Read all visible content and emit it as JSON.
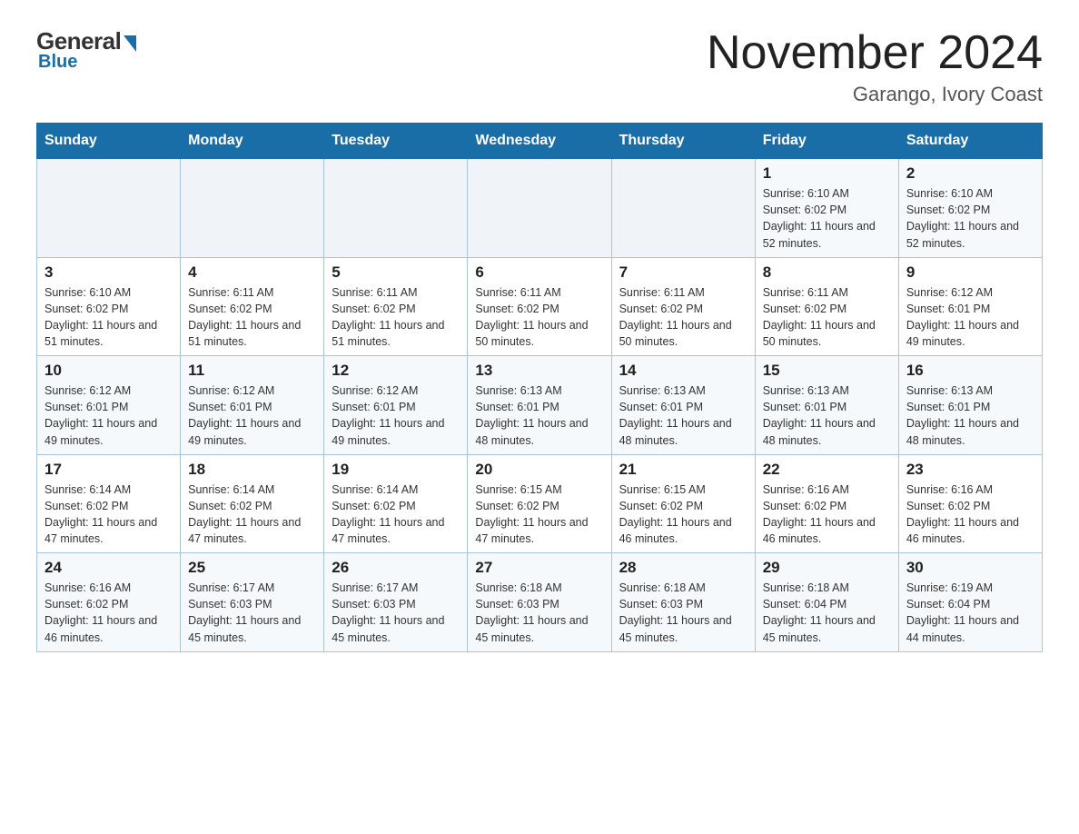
{
  "logo": {
    "general": "General",
    "blue": "Blue"
  },
  "header": {
    "month_year": "November 2024",
    "location": "Garango, Ivory Coast"
  },
  "days_of_week": [
    "Sunday",
    "Monday",
    "Tuesday",
    "Wednesday",
    "Thursday",
    "Friday",
    "Saturday"
  ],
  "weeks": [
    [
      {
        "day": "",
        "info": ""
      },
      {
        "day": "",
        "info": ""
      },
      {
        "day": "",
        "info": ""
      },
      {
        "day": "",
        "info": ""
      },
      {
        "day": "",
        "info": ""
      },
      {
        "day": "1",
        "info": "Sunrise: 6:10 AM\nSunset: 6:02 PM\nDaylight: 11 hours and 52 minutes."
      },
      {
        "day": "2",
        "info": "Sunrise: 6:10 AM\nSunset: 6:02 PM\nDaylight: 11 hours and 52 minutes."
      }
    ],
    [
      {
        "day": "3",
        "info": "Sunrise: 6:10 AM\nSunset: 6:02 PM\nDaylight: 11 hours and 51 minutes."
      },
      {
        "day": "4",
        "info": "Sunrise: 6:11 AM\nSunset: 6:02 PM\nDaylight: 11 hours and 51 minutes."
      },
      {
        "day": "5",
        "info": "Sunrise: 6:11 AM\nSunset: 6:02 PM\nDaylight: 11 hours and 51 minutes."
      },
      {
        "day": "6",
        "info": "Sunrise: 6:11 AM\nSunset: 6:02 PM\nDaylight: 11 hours and 50 minutes."
      },
      {
        "day": "7",
        "info": "Sunrise: 6:11 AM\nSunset: 6:02 PM\nDaylight: 11 hours and 50 minutes."
      },
      {
        "day": "8",
        "info": "Sunrise: 6:11 AM\nSunset: 6:02 PM\nDaylight: 11 hours and 50 minutes."
      },
      {
        "day": "9",
        "info": "Sunrise: 6:12 AM\nSunset: 6:01 PM\nDaylight: 11 hours and 49 minutes."
      }
    ],
    [
      {
        "day": "10",
        "info": "Sunrise: 6:12 AM\nSunset: 6:01 PM\nDaylight: 11 hours and 49 minutes."
      },
      {
        "day": "11",
        "info": "Sunrise: 6:12 AM\nSunset: 6:01 PM\nDaylight: 11 hours and 49 minutes."
      },
      {
        "day": "12",
        "info": "Sunrise: 6:12 AM\nSunset: 6:01 PM\nDaylight: 11 hours and 49 minutes."
      },
      {
        "day": "13",
        "info": "Sunrise: 6:13 AM\nSunset: 6:01 PM\nDaylight: 11 hours and 48 minutes."
      },
      {
        "day": "14",
        "info": "Sunrise: 6:13 AM\nSunset: 6:01 PM\nDaylight: 11 hours and 48 minutes."
      },
      {
        "day": "15",
        "info": "Sunrise: 6:13 AM\nSunset: 6:01 PM\nDaylight: 11 hours and 48 minutes."
      },
      {
        "day": "16",
        "info": "Sunrise: 6:13 AM\nSunset: 6:01 PM\nDaylight: 11 hours and 48 minutes."
      }
    ],
    [
      {
        "day": "17",
        "info": "Sunrise: 6:14 AM\nSunset: 6:02 PM\nDaylight: 11 hours and 47 minutes."
      },
      {
        "day": "18",
        "info": "Sunrise: 6:14 AM\nSunset: 6:02 PM\nDaylight: 11 hours and 47 minutes."
      },
      {
        "day": "19",
        "info": "Sunrise: 6:14 AM\nSunset: 6:02 PM\nDaylight: 11 hours and 47 minutes."
      },
      {
        "day": "20",
        "info": "Sunrise: 6:15 AM\nSunset: 6:02 PM\nDaylight: 11 hours and 47 minutes."
      },
      {
        "day": "21",
        "info": "Sunrise: 6:15 AM\nSunset: 6:02 PM\nDaylight: 11 hours and 46 minutes."
      },
      {
        "day": "22",
        "info": "Sunrise: 6:16 AM\nSunset: 6:02 PM\nDaylight: 11 hours and 46 minutes."
      },
      {
        "day": "23",
        "info": "Sunrise: 6:16 AM\nSunset: 6:02 PM\nDaylight: 11 hours and 46 minutes."
      }
    ],
    [
      {
        "day": "24",
        "info": "Sunrise: 6:16 AM\nSunset: 6:02 PM\nDaylight: 11 hours and 46 minutes."
      },
      {
        "day": "25",
        "info": "Sunrise: 6:17 AM\nSunset: 6:03 PM\nDaylight: 11 hours and 45 minutes."
      },
      {
        "day": "26",
        "info": "Sunrise: 6:17 AM\nSunset: 6:03 PM\nDaylight: 11 hours and 45 minutes."
      },
      {
        "day": "27",
        "info": "Sunrise: 6:18 AM\nSunset: 6:03 PM\nDaylight: 11 hours and 45 minutes."
      },
      {
        "day": "28",
        "info": "Sunrise: 6:18 AM\nSunset: 6:03 PM\nDaylight: 11 hours and 45 minutes."
      },
      {
        "day": "29",
        "info": "Sunrise: 6:18 AM\nSunset: 6:04 PM\nDaylight: 11 hours and 45 minutes."
      },
      {
        "day": "30",
        "info": "Sunrise: 6:19 AM\nSunset: 6:04 PM\nDaylight: 11 hours and 44 minutes."
      }
    ]
  ]
}
